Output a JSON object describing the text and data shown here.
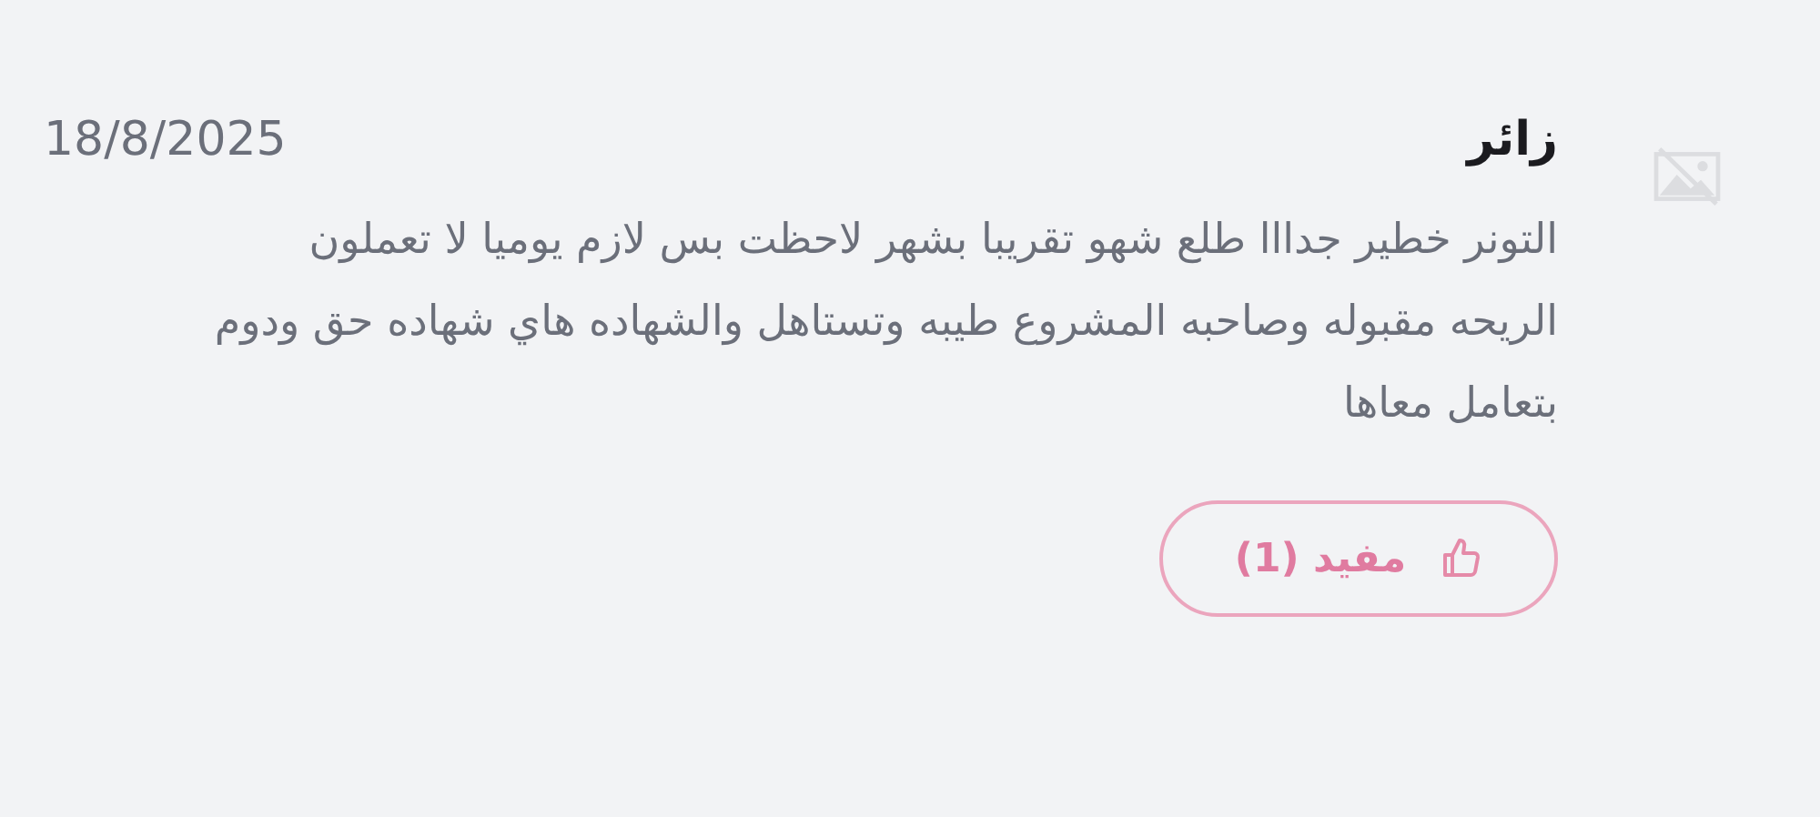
{
  "review": {
    "author": "زائر",
    "date": "18/8/2025",
    "text": "التونر خطير جدااا طلع شهو تقريبا بشهر لاحظت بس لازم يوميا لا تعملون الريحه مقبوله وصاحبه المشروع طيبه وتستاهل والشهاده هاي شهاده حق ودوم بتعامل معاها",
    "helpful_button": {
      "label": "مفيد (1)"
    }
  }
}
